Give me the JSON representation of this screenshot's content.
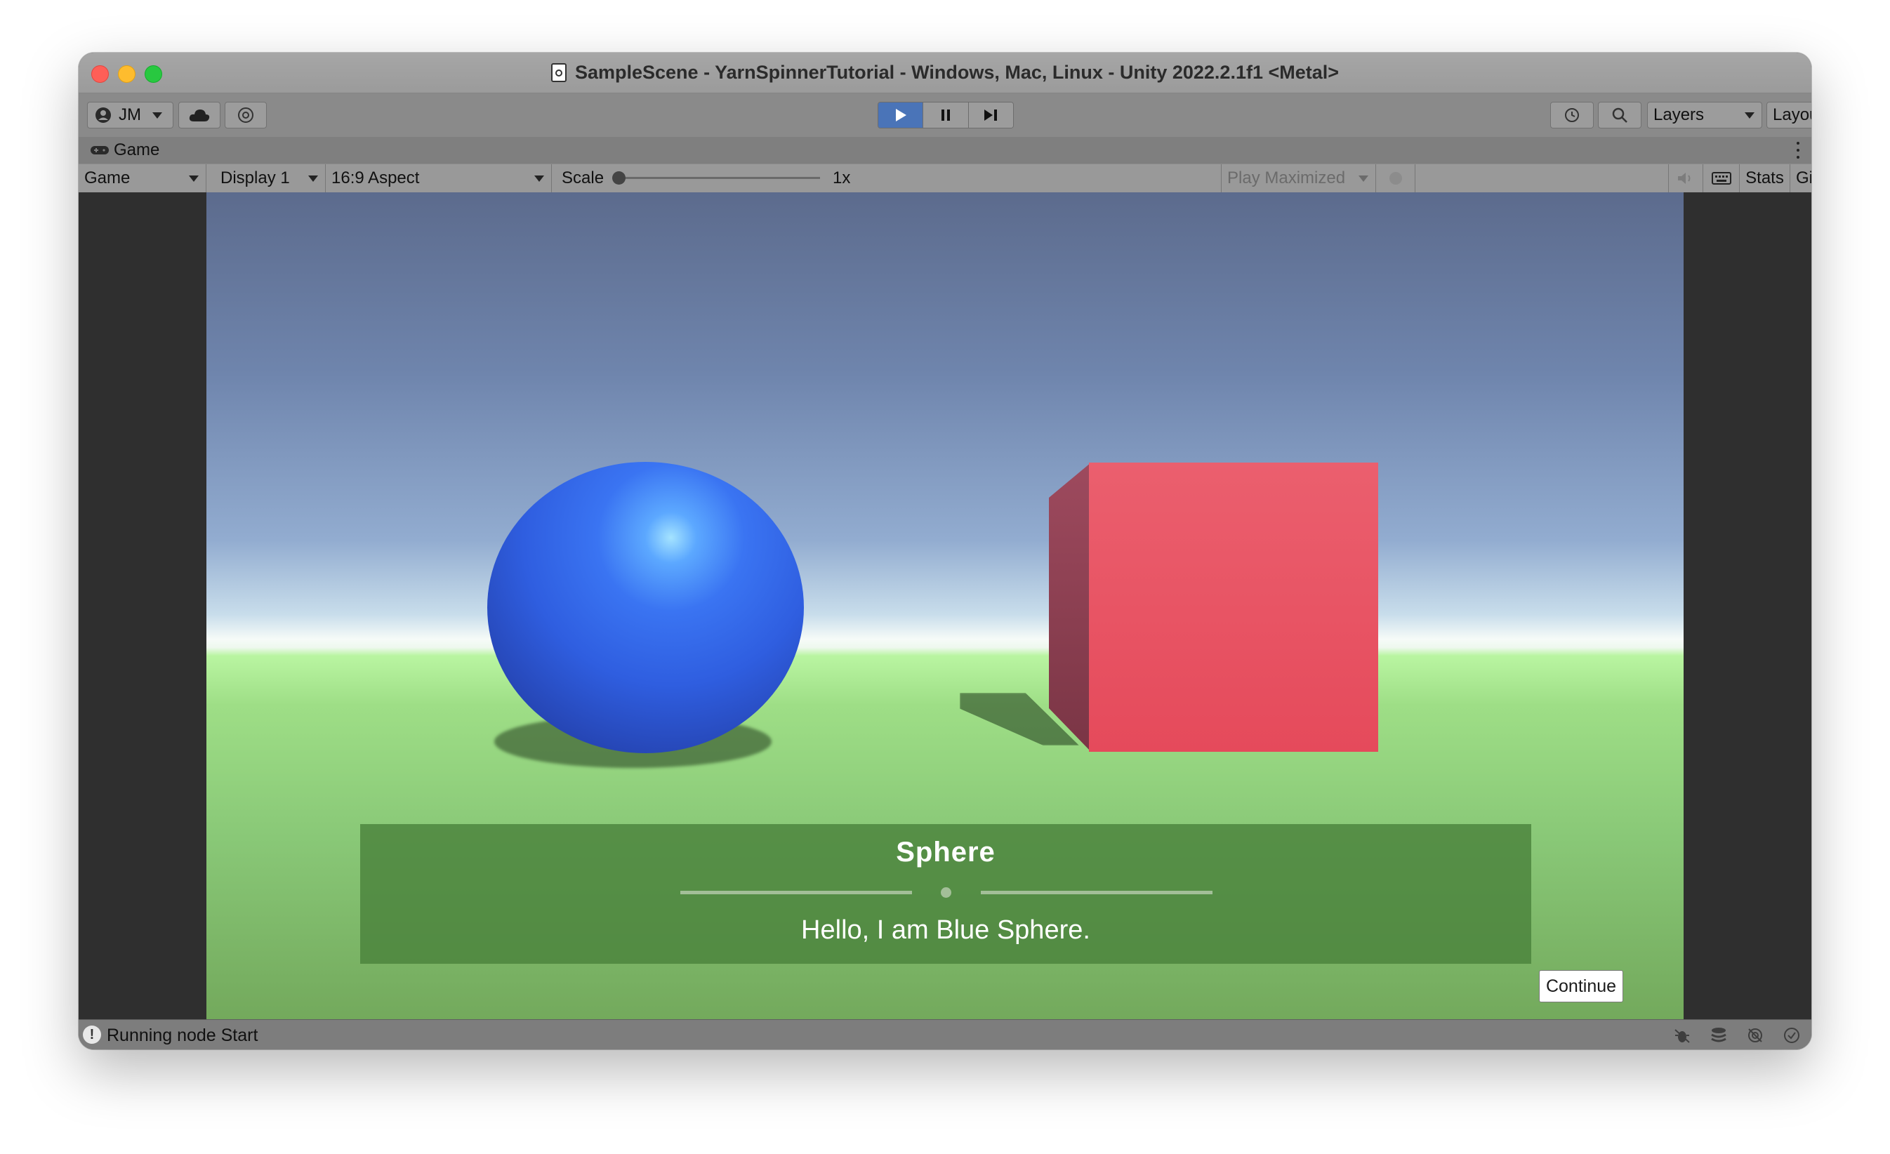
{
  "window": {
    "title": "SampleScene - YarnSpinnerTutorial - Windows, Mac, Linux - Unity 2022.2.1f1 <Metal>"
  },
  "toolbar": {
    "account_label": "JM",
    "layers_label": "Layers",
    "layout_label": "Layout"
  },
  "panel": {
    "tab_label": "Game"
  },
  "game_bar": {
    "mode_label": "Game",
    "display_label": "Display 1",
    "aspect_label": "16:9 Aspect",
    "scale_label": "Scale",
    "scale_value": "1x",
    "scale_slider_fraction": 0,
    "play_maximized_label": "Play Maximized",
    "stats_label": "Stats",
    "gizmos_label": "Gizmos"
  },
  "dialogue": {
    "speaker": "Sphere",
    "line": "Hello, I am Blue Sphere.",
    "continue_label": "Continue"
  },
  "status": {
    "message": "Running node Start"
  },
  "colors": {
    "play_active": "#4a74b8",
    "sphere": "#3a6cf0",
    "cube": "#e85566",
    "dialogue_bg": "#4f833d"
  },
  "icons": {
    "account": "person-icon",
    "cloud": "cloud-icon",
    "collab": "collab-icon",
    "history": "history-icon",
    "search": "search-icon",
    "game_tab": "gamepad-icon",
    "mute": "speaker-icon",
    "keyboard": "keyboard-icon",
    "status": "warning-icon"
  }
}
